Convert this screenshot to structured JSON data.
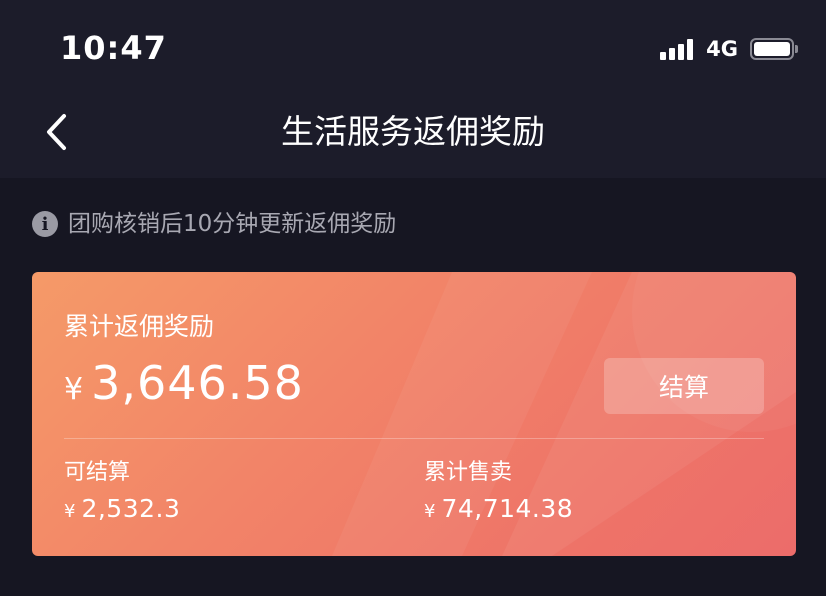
{
  "status_bar": {
    "time": "10:47",
    "network": "4G",
    "icons": [
      "signal-icon",
      "battery-icon"
    ]
  },
  "header": {
    "title": "生活服务返佣奖励",
    "back_icon": "chevron-left-icon"
  },
  "notice": {
    "icon": "info-icon",
    "icon_glyph": "i",
    "text": "团购核销后10分钟更新返佣奖励"
  },
  "card": {
    "label": "累计返佣奖励",
    "currency": "¥",
    "amount": "3,646.58",
    "settle_button_label": "结算",
    "stats": [
      {
        "label": "可结算",
        "currency": "¥",
        "value": "2,532.3"
      },
      {
        "label": "累计售卖",
        "currency": "¥",
        "value": "74,714.38"
      }
    ]
  },
  "colors": {
    "background": "#161622",
    "header_bg": "#1c1c2a",
    "card_gradient_start": "#f59a68",
    "card_gradient_end": "#ec6c6a",
    "notice_text": "#a8a8b2"
  }
}
